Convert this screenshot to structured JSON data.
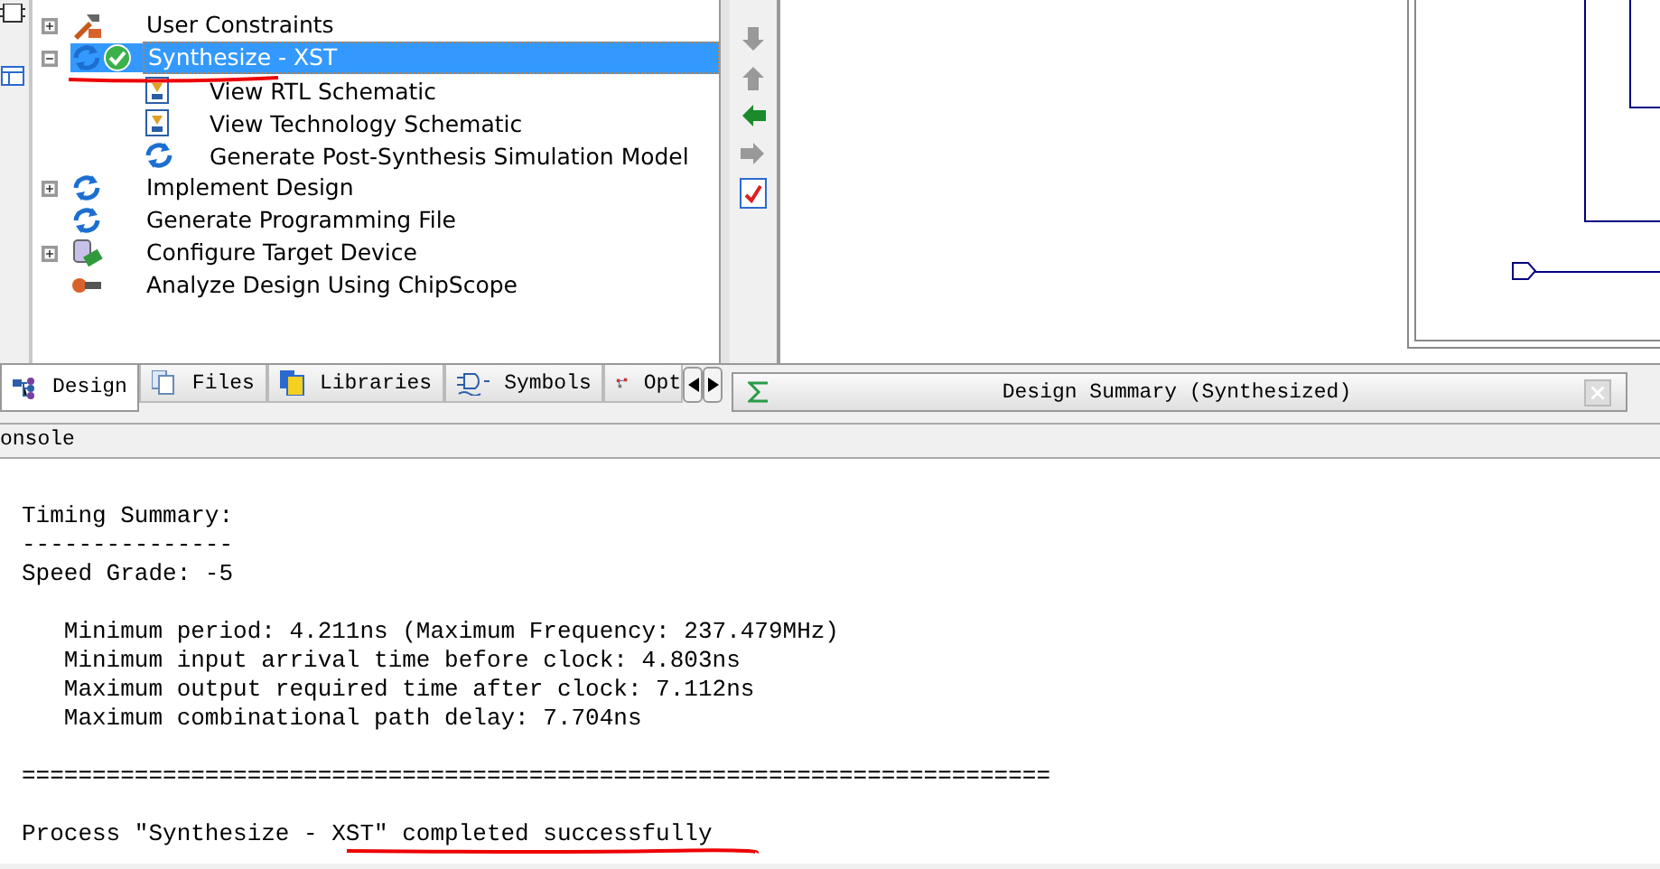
{
  "process_tree": [
    {
      "label": "User Constraints",
      "kind": "tools",
      "expanded": false,
      "selected": false
    },
    {
      "label": "Synthesize - XST",
      "kind": "process",
      "completed": true,
      "expanded": true,
      "selected": true,
      "children": [
        {
          "label": "View RTL Schematic",
          "kind": "schematic"
        },
        {
          "label": "View Technology Schematic",
          "kind": "schematic"
        },
        {
          "label": "Generate Post-Synthesis Simulation Model",
          "kind": "process"
        }
      ]
    },
    {
      "label": "Implement Design",
      "kind": "process",
      "expanded": false,
      "selected": false
    },
    {
      "label": "Generate Programming File",
      "kind": "process",
      "selected": false
    },
    {
      "label": "Configure Target Device",
      "kind": "device",
      "expanded": false,
      "selected": false
    },
    {
      "label": "Analyze Design Using ChipScope",
      "kind": "probe",
      "selected": false
    }
  ],
  "panel_tabs": [
    {
      "label": "Design",
      "kind": "design",
      "selected": true
    },
    {
      "label": "Files",
      "kind": "files",
      "selected": false
    },
    {
      "label": "Libraries",
      "kind": "libraries",
      "selected": false
    },
    {
      "label": "Symbols",
      "kind": "symbols",
      "selected": false
    },
    {
      "label": "Opt",
      "kind": "options",
      "selected": false
    }
  ],
  "document_tab": {
    "title": "Design Summary (Synthesized)"
  },
  "console": {
    "title": "onsole",
    "blocks": [
      [
        "Timing Summary:",
        "---------------",
        "Speed Grade: -5"
      ],
      [
        "   Minimum period: 4.211ns (Maximum Frequency: 237.479MHz)",
        "   Minimum input arrival time before clock: 4.803ns",
        "   Maximum output required time after clock: 7.112ns",
        "   Maximum combinational path delay: 7.704ns"
      ],
      [
        "========================================================================="
      ],
      [
        "Process \"Synthesize - XST\" completed successfully"
      ]
    ]
  }
}
